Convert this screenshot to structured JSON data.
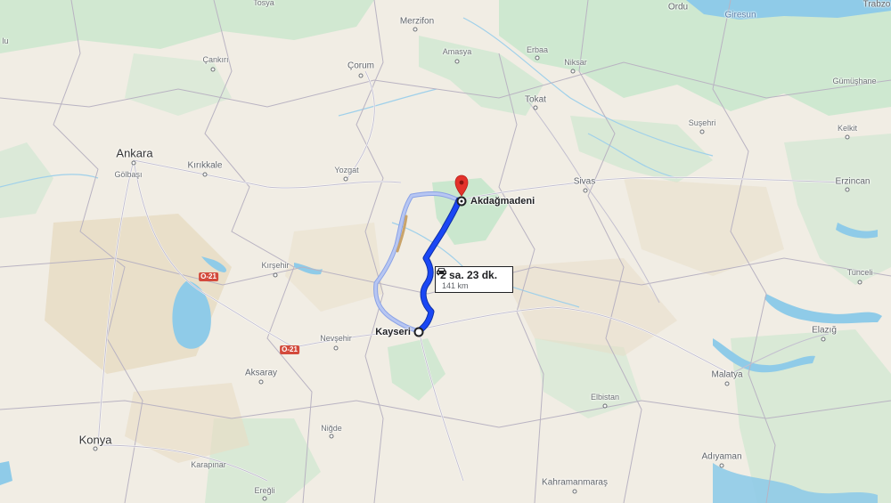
{
  "map": {
    "cities": {
      "tosya": "Tosya",
      "merzifon": "Merzifon",
      "ordu": "Ordu",
      "giresun": "Giresun",
      "trabzon": "Trabzo",
      "cankiri": "Çankırı",
      "corum": "Çorum",
      "amasya": "Amasya",
      "erbaa": "Erbaa",
      "niksar": "Niksar",
      "gumushane": "Gümüşhane",
      "tokat": "Tokat",
      "susehri": "Suşehri",
      "kelkit": "Kelkit",
      "ankara": "Ankara",
      "golbasi": "Gölbaşı",
      "kirikkale": "Kırıkkale",
      "yozgat": "Yozgat",
      "sivas": "Sivas",
      "erzincan": "Erzincan",
      "kirsehir": "Kırşehir",
      "tunceli": "Tunceli",
      "nevsehir": "Nevşehir",
      "elazig": "Elazığ",
      "aksaray": "Aksaray",
      "malatya": "Malatya",
      "elbistan": "Elbistan",
      "konya": "Konya",
      "nigde": "Niğde",
      "karapinar": "Karapınar",
      "adiyaman": "Adıyaman",
      "eregli": "Ereğli",
      "kahramanmaras": "Kahramanmaraş",
      "edge_left": "lu"
    },
    "road_shields": [
      "O-21",
      "O-21"
    ],
    "route": {
      "origin": "Kayseri",
      "destination": "Akdağmadeni",
      "duration": "2 sa. 23 dk.",
      "distance": "141 km",
      "mode_icon": "car-icon"
    },
    "colors": {
      "land": "#f1ede4",
      "forest": "#bfe3c6",
      "water": "#8fcbe8",
      "route_primary": "#1a47f5",
      "route_alt": "#a3b6ee",
      "destination_pin": "#e3322b"
    }
  }
}
